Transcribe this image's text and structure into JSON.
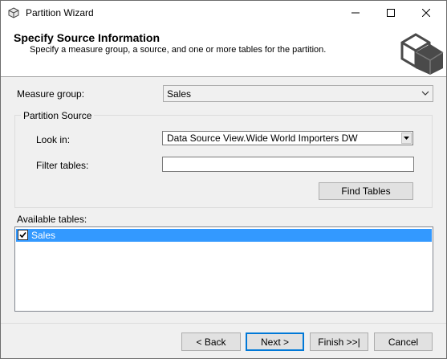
{
  "window": {
    "title": "Partition Wizard",
    "controls": {
      "minimize_icon": "minimize-icon",
      "maximize_icon": "maximize-icon",
      "close_icon": "close-icon"
    }
  },
  "header": {
    "title": "Specify Source Information",
    "subtitle": "Specify a measure group, a source, and one or more tables for the partition.",
    "art_icon": "cube-icon"
  },
  "measure_group": {
    "label": "Measure group:",
    "value": "Sales"
  },
  "partition_source": {
    "group_label": "Partition Source",
    "look_in": {
      "label": "Look in:",
      "value": "Data Source View.Wide World Importers DW"
    },
    "filter_tables": {
      "label": "Filter tables:",
      "value": ""
    },
    "find_button": "Find Tables"
  },
  "available_tables": {
    "label": "Available tables:",
    "items": [
      {
        "label": "Sales",
        "checked": true,
        "selected": true
      }
    ]
  },
  "footer": {
    "back": "< Back",
    "next": "Next >",
    "finish": "Finish >>|",
    "cancel": "Cancel"
  },
  "colors": {
    "selection": "#3399ff",
    "accent": "#0078d7",
    "dialog_bg": "#f0f0f0"
  }
}
